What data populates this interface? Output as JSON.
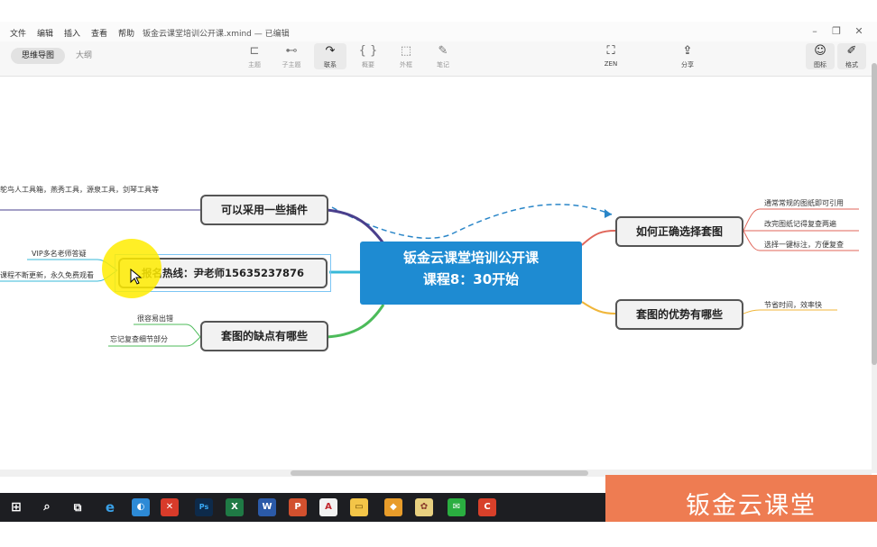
{
  "menu": [
    "文件",
    "编辑",
    "插入",
    "查看",
    "帮助"
  ],
  "document_title": "钣金云课堂培训公开课.xmind — 已编辑",
  "view_tabs": {
    "active": "思维导图",
    "other": "大纲"
  },
  "toolbar": {
    "topic": "主题",
    "subtopic": "子主题",
    "relationship": "联系",
    "summary": "概要",
    "boundary": "外框",
    "note": "笔记",
    "zen": "ZEN",
    "share": "分享",
    "icon_panel": "图标",
    "format_panel": "格式"
  },
  "mindmap": {
    "central": {
      "line1": "钣金云课堂培训公开课",
      "line2": "课程8：30开始"
    },
    "left_topics": [
      {
        "label": "可以采用一些插件",
        "leaves": [
          "鸵鸟人工具箱，燕秀工具，源泉工具，剑琴工具等"
        ]
      },
      {
        "label": "报名热线：尹老师15635237876",
        "leaves": [
          "VIP多名老师答疑",
          "课程不断更新，永久免费观看"
        ]
      },
      {
        "label": "套图的缺点有哪些",
        "leaves": [
          "很容易出错",
          "忘记复查细节部分"
        ]
      }
    ],
    "right_topics": [
      {
        "label": "如何正确选择套图",
        "leaves": [
          "通常常规的图纸即可引用",
          "改完图纸记得复查两遍",
          "选择一键标注，方便复查"
        ]
      },
      {
        "label": "套图的优势有哪些",
        "leaves": [
          "节省时间，效率快"
        ]
      }
    ]
  },
  "branch_colors": {
    "purple": "#4a3f8c",
    "cyan": "#37b8d8",
    "green": "#4cbb5a",
    "red": "#e0665a",
    "orange": "#f0b63a",
    "dashed": "#2a86c8"
  },
  "watermark": "钣金云课堂",
  "taskbar_icons": [
    "windows-start",
    "search",
    "task-view",
    "edge",
    "browser",
    "xmind",
    "photoshop",
    "excel",
    "word",
    "powerpoint",
    "autocad",
    "file-explorer",
    "app-orange",
    "app-paint",
    "wechat",
    "app-red"
  ]
}
